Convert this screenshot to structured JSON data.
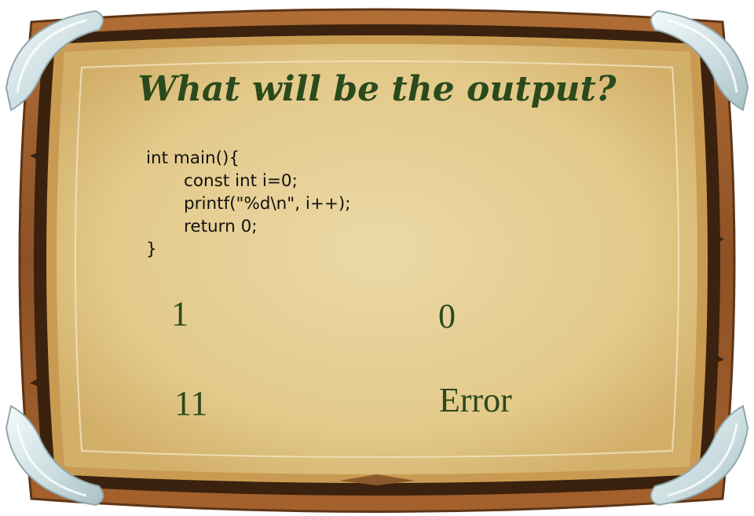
{
  "question": {
    "title": "What will be the output?",
    "code_lines": [
      "int main(){",
      "const int i=0;",
      "printf(\"%d\\n\", i++);",
      "return 0;",
      "}"
    ]
  },
  "options": [
    "1",
    "0",
    "11",
    "Error"
  ],
  "colors": {
    "title_text": "#2a4a1c",
    "board_fill": "#e8d39e",
    "frame_wood": "#9b5d2e",
    "frame_dark": "#3b220e",
    "corner_glass": "#dce9ea"
  }
}
